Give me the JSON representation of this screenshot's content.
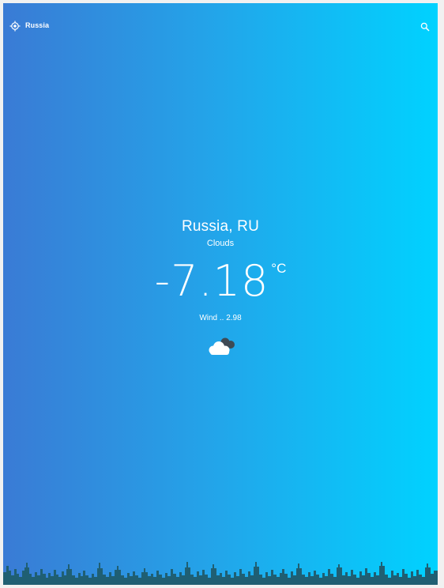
{
  "header": {
    "location_label": "Russia",
    "location_icon": "crosshair-icon",
    "search_icon": "search-icon"
  },
  "weather": {
    "city": "Russia, RU",
    "condition": "Clouds",
    "temperature": "-7.18",
    "unit": "°C",
    "wind_label": "Wind ..",
    "wind_value": "2.98",
    "condition_icon": "cloud-icon"
  },
  "theme": {
    "gradient_start": "#3a7bd5",
    "gradient_end": "#00d2ff",
    "skyline_color": "#1f5f73"
  }
}
